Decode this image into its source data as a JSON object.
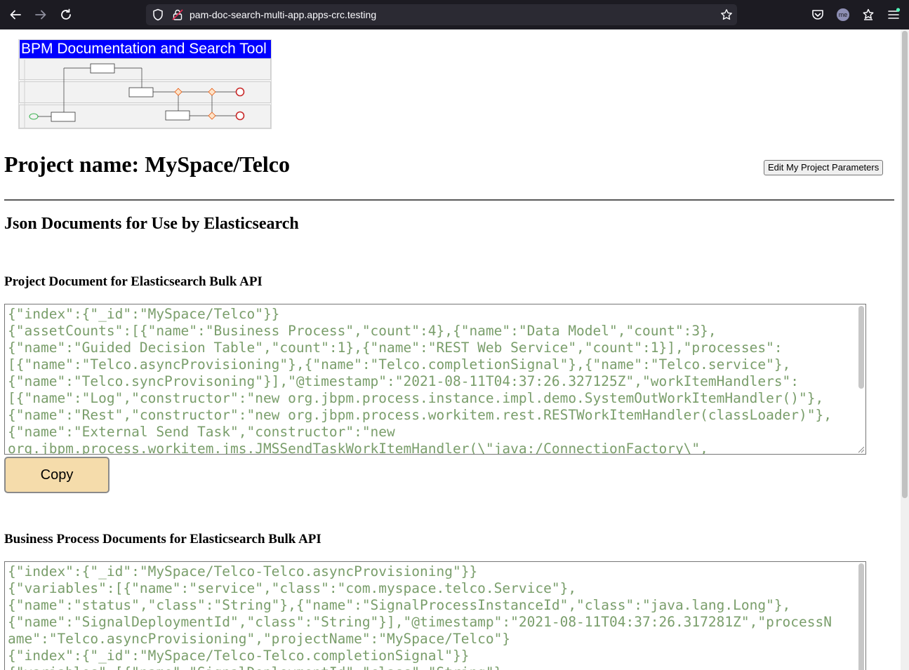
{
  "browser": {
    "url": "pam-doc-search-multi-app.apps-crc.testing",
    "avatar_initials": "me"
  },
  "logo": {
    "title": "BPM Documentation and Search Tool"
  },
  "header": {
    "title": "Project name: MySpace/Telco",
    "edit_button_label": "Edit My Project Parameters"
  },
  "section": {
    "title": "Json Documents for Use by Elasticsearch"
  },
  "project_doc": {
    "heading": "Project Document for Elasticsearch Bulk API",
    "content": "{\"index\":{\"_id\":\"MySpace/Telco\"}}\n{\"assetCounts\":[{\"name\":\"Business Process\",\"count\":4},{\"name\":\"Data Model\",\"count\":3},\n{\"name\":\"Guided Decision Table\",\"count\":1},{\"name\":\"REST Web Service\",\"count\":1}],\"processes\":\n[{\"name\":\"Telco.asyncProvisioning\"},{\"name\":\"Telco.completionSignal\"},{\"name\":\"Telco.service\"},\n{\"name\":\"Telco.syncProvisoning\"}],\"@timestamp\":\"2021-08-11T04:37:26.327125Z\",\"workItemHandlers\":\n[{\"name\":\"Log\",\"constructor\":\"new org.jbpm.process.instance.impl.demo.SystemOutWorkItemHandler()\"},\n{\"name\":\"Rest\",\"constructor\":\"new org.jbpm.process.workitem.rest.RESTWorkItemHandler(classLoader)\"},\n{\"name\":\"External Send Task\",\"constructor\":\"new\norg.jbpm.process.workitem.jms.JMSSendTaskWorkItemHandler(\\\"java:/ConnectionFactory\\\","
  },
  "copy_button_label": "Copy",
  "process_doc": {
    "heading": "Business Process Documents for Elasticsearch Bulk API",
    "content": "{\"index\":{\"_id\":\"MySpace/Telco-Telco.asyncProvisioning\"}}\n{\"variables\":[{\"name\":\"service\",\"class\":\"com.myspace.telco.Service\"},\n{\"name\":\"status\",\"class\":\"String\"},{\"name\":\"SignalProcessInstanceId\",\"class\":\"java.lang.Long\"},\n{\"name\":\"SignalDeploymentId\",\"class\":\"String\"}],\"@timestamp\":\"2021-08-11T04:37:26.317281Z\",\"processN\name\":\"Telco.asyncProvisioning\",\"projectName\":\"MySpace/Telco\"}\n{\"index\":{\"_id\":\"MySpace/Telco-Telco.completionSignal\"}}\n{\"variables\":[{\"name\":\"SignalDeploymentId\",\"class\":\"String\"},"
  },
  "colors": {
    "chrome_bg": "#1c1b22",
    "logo_banner": "#0000ff",
    "json_text": "#7a9e6b",
    "copy_button": "#f5dcab"
  }
}
